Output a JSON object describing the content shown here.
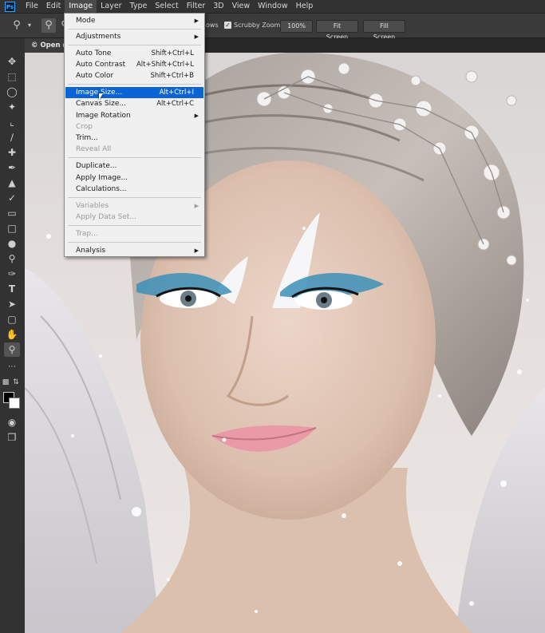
{
  "menubar": {
    "app_icon": "Ps",
    "items": [
      {
        "label": "File"
      },
      {
        "label": "Edit"
      },
      {
        "label": "Image"
      },
      {
        "label": "Layer"
      },
      {
        "label": "Type"
      },
      {
        "label": "Select"
      },
      {
        "label": "Filter"
      },
      {
        "label": "3D"
      },
      {
        "label": "View"
      },
      {
        "label": "Window"
      },
      {
        "label": "Help"
      }
    ],
    "active_item": "Image"
  },
  "options": {
    "partial_label": "ows",
    "scrubby_zoom_label": "Scrubby Zoom",
    "scrubby_zoom_checked": true,
    "zoom_100_label": "100%",
    "fit_screen_label": "Fit Screen",
    "fill_screen_label": "Fill Screen"
  },
  "document": {
    "tab_label": "© Open @"
  },
  "tools": [
    "move-icon",
    "marquee-icon",
    "lasso-icon",
    "quick-select-icon",
    "crop-icon",
    "eyedropper-icon",
    "healing-brush-icon",
    "brush-icon",
    "clone-stamp-icon",
    "history-brush-icon",
    "eraser-icon",
    "gradient-icon",
    "blur-icon",
    "dodge-icon",
    "pen-icon",
    "type-icon",
    "path-select-icon",
    "rectangle-icon",
    "hand-icon",
    "zoom-icon",
    "more-tools-icon"
  ],
  "image_menu": {
    "items": [
      {
        "label": "Mode",
        "shortcut": "",
        "submenu": true,
        "enabled": true
      },
      {
        "label": "Adjustments",
        "shortcut": "",
        "submenu": true,
        "enabled": true
      },
      {
        "label": "Auto Tone",
        "shortcut": "Shift+Ctrl+L",
        "submenu": false,
        "enabled": true
      },
      {
        "label": "Auto Contrast",
        "shortcut": "Alt+Shift+Ctrl+L",
        "submenu": false,
        "enabled": true
      },
      {
        "label": "Auto Color",
        "shortcut": "Shift+Ctrl+B",
        "submenu": false,
        "enabled": true
      },
      {
        "label": "Image Size...",
        "shortcut": "Alt+Ctrl+I",
        "submenu": false,
        "enabled": true,
        "highlighted": true
      },
      {
        "label": "Canvas Size...",
        "shortcut": "Alt+Ctrl+C",
        "submenu": false,
        "enabled": true
      },
      {
        "label": "Image Rotation",
        "shortcut": "",
        "submenu": true,
        "enabled": true
      },
      {
        "label": "Crop",
        "shortcut": "",
        "submenu": false,
        "enabled": false
      },
      {
        "label": "Trim...",
        "shortcut": "",
        "submenu": false,
        "enabled": true
      },
      {
        "label": "Reveal All",
        "shortcut": "",
        "submenu": false,
        "enabled": false
      },
      {
        "label": "Duplicate...",
        "shortcut": "",
        "submenu": false,
        "enabled": true
      },
      {
        "label": "Apply Image...",
        "shortcut": "",
        "submenu": false,
        "enabled": true
      },
      {
        "label": "Calculations...",
        "shortcut": "",
        "submenu": false,
        "enabled": true
      },
      {
        "label": "Variables",
        "shortcut": "",
        "submenu": true,
        "enabled": false
      },
      {
        "label": "Apply Data Set...",
        "shortcut": "",
        "submenu": false,
        "enabled": false
      },
      {
        "label": "Trap...",
        "shortcut": "",
        "submenu": false,
        "enabled": false
      },
      {
        "label": "Analysis",
        "shortcut": "",
        "submenu": true,
        "enabled": true
      }
    ]
  },
  "colors": {
    "accent": "#0a64d6",
    "ps_blue": "#31a8ff",
    "panel": "#323232"
  }
}
